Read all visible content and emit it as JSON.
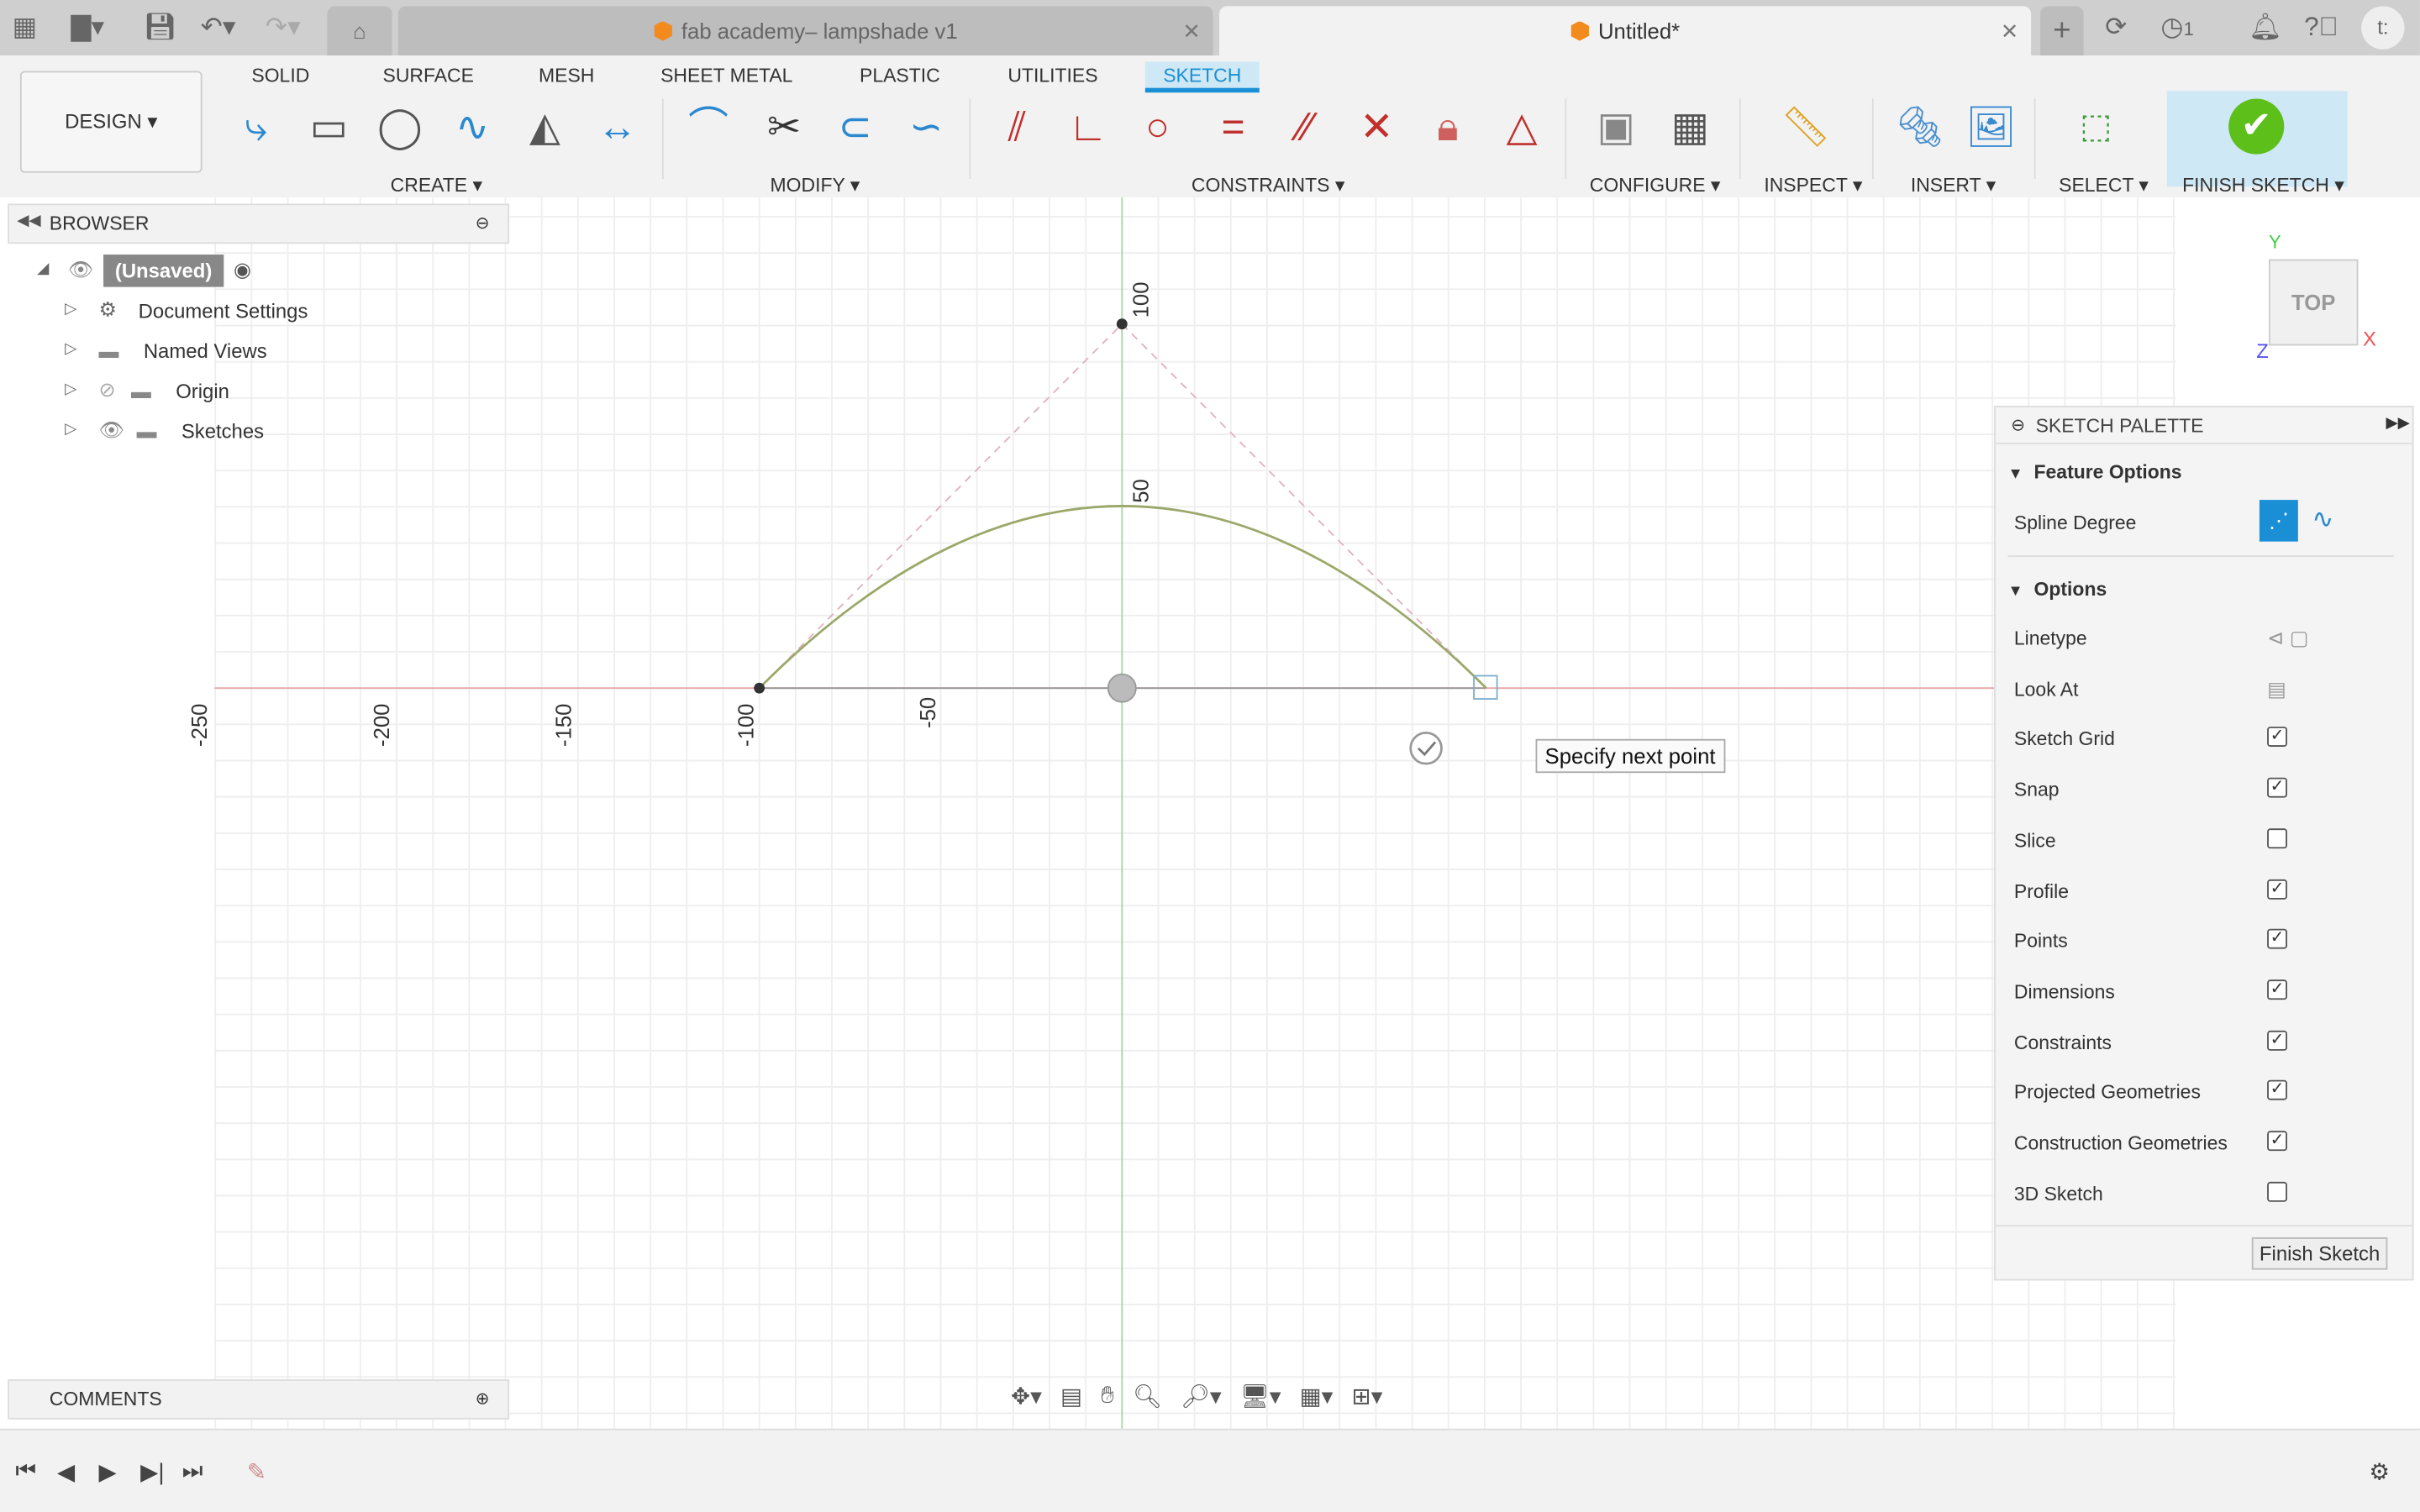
{
  "tabs": [
    {
      "label": "fab academy– lampshade v1",
      "active": false
    },
    {
      "label": "Untitled*",
      "active": true
    }
  ],
  "ribbon": {
    "workspace": "DESIGN ▾",
    "tabs": [
      "SOLID",
      "SURFACE",
      "MESH",
      "SHEET METAL",
      "PLASTIC",
      "UTILITIES",
      "SKETCH"
    ],
    "active_tab": "SKETCH",
    "groups": [
      "CREATE ▾",
      "MODIFY ▾",
      "CONSTRAINTS ▾",
      "CONFIGURE ▾",
      "INSPECT ▾",
      "INSERT ▾",
      "SELECT ▾",
      "FINISH SKETCH ▾"
    ]
  },
  "topbar": {
    "job_count": "1"
  },
  "browser": {
    "title": "BROWSER",
    "items": [
      {
        "label": "(Unsaved)"
      },
      {
        "label": "Document Settings"
      },
      {
        "label": "Named Views"
      },
      {
        "label": "Origin"
      },
      {
        "label": "Sketches"
      }
    ]
  },
  "comments": {
    "title": "COMMENTS"
  },
  "canvas": {
    "x_labels": [
      "-250",
      "-200",
      "-150",
      "-100",
      "-50"
    ],
    "y_labels": [
      "100",
      "50"
    ],
    "tooltip": "Specify next point",
    "viewcube": {
      "face": "TOP",
      "x": "X",
      "y": "Y",
      "z": "Z"
    }
  },
  "palette": {
    "title": "SKETCH PALETTE",
    "feature_options": "Feature Options",
    "spline_degree": "Spline Degree",
    "options": "Options",
    "rows": [
      {
        "label": "Linetype"
      },
      {
        "label": "Look At"
      },
      {
        "label": "Sketch Grid",
        "checked": true
      },
      {
        "label": "Snap",
        "checked": true
      },
      {
        "label": "Slice",
        "checked": false
      },
      {
        "label": "Profile",
        "checked": true
      },
      {
        "label": "Points",
        "checked": true
      },
      {
        "label": "Dimensions",
        "checked": true
      },
      {
        "label": "Constraints",
        "checked": true
      },
      {
        "label": "Projected Geometries",
        "checked": true
      },
      {
        "label": "Construction Geometries",
        "checked": true
      },
      {
        "label": "3D Sketch",
        "checked": false
      }
    ],
    "finish_button": "Finish Sketch"
  },
  "colors": {
    "accent": "#1a8fd6",
    "finish_green": "#5cbf1a",
    "constraint_red": "#c0302c"
  }
}
